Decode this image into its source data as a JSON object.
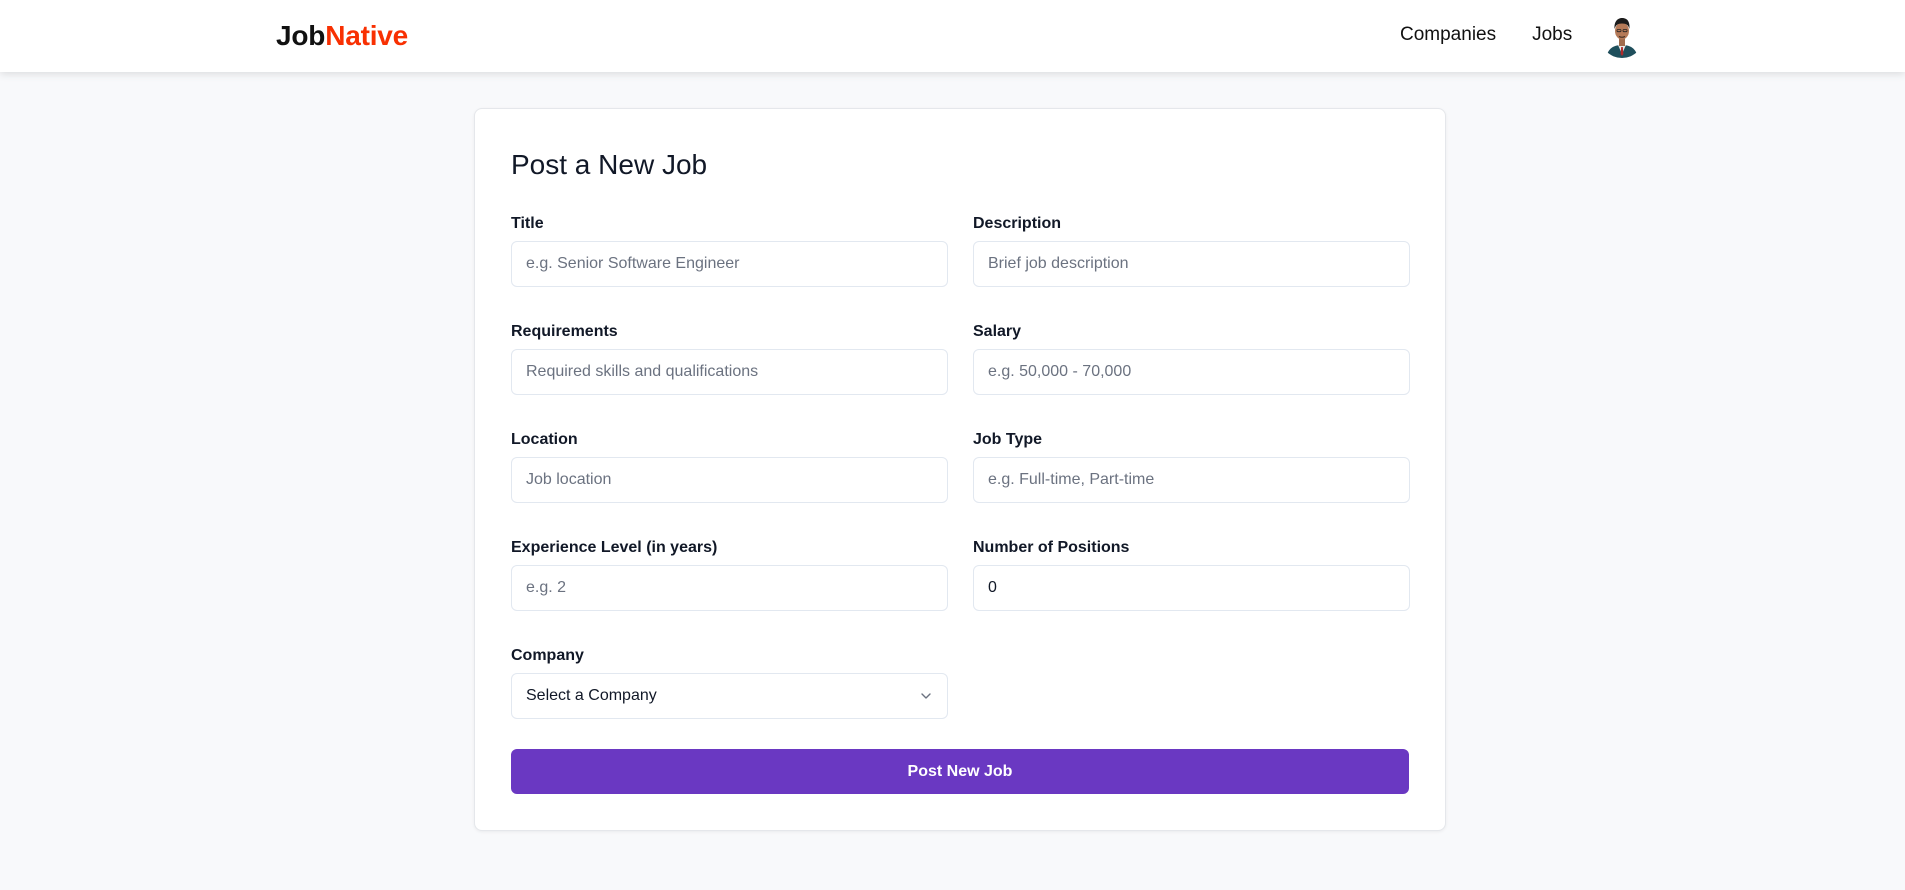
{
  "navbar": {
    "logo_part1": "Job",
    "logo_part2": "Native",
    "links": [
      "Companies",
      "Jobs"
    ],
    "accent_color": "#f83002"
  },
  "form": {
    "title": "Post a New Job",
    "fields": {
      "title": {
        "label": "Title",
        "placeholder": "e.g. Senior Software Engineer",
        "value": ""
      },
      "description": {
        "label": "Description",
        "placeholder": "Brief job description",
        "value": ""
      },
      "requirements": {
        "label": "Requirements",
        "placeholder": "Required skills and qualifications",
        "value": ""
      },
      "salary": {
        "label": "Salary",
        "placeholder": "e.g. 50,000 - 70,000",
        "value": ""
      },
      "location": {
        "label": "Location",
        "placeholder": "Job location",
        "value": ""
      },
      "job_type": {
        "label": "Job Type",
        "placeholder": "e.g. Full-time, Part-time",
        "value": ""
      },
      "experience": {
        "label": "Experience Level (in years)",
        "placeholder": "e.g. 2",
        "value": ""
      },
      "positions": {
        "label": "Number of Positions",
        "placeholder": "",
        "value": "0"
      },
      "company": {
        "label": "Company",
        "selected": "Select a Company"
      }
    },
    "submit_label": "Post New Job",
    "button_color": "#6a38c2"
  }
}
